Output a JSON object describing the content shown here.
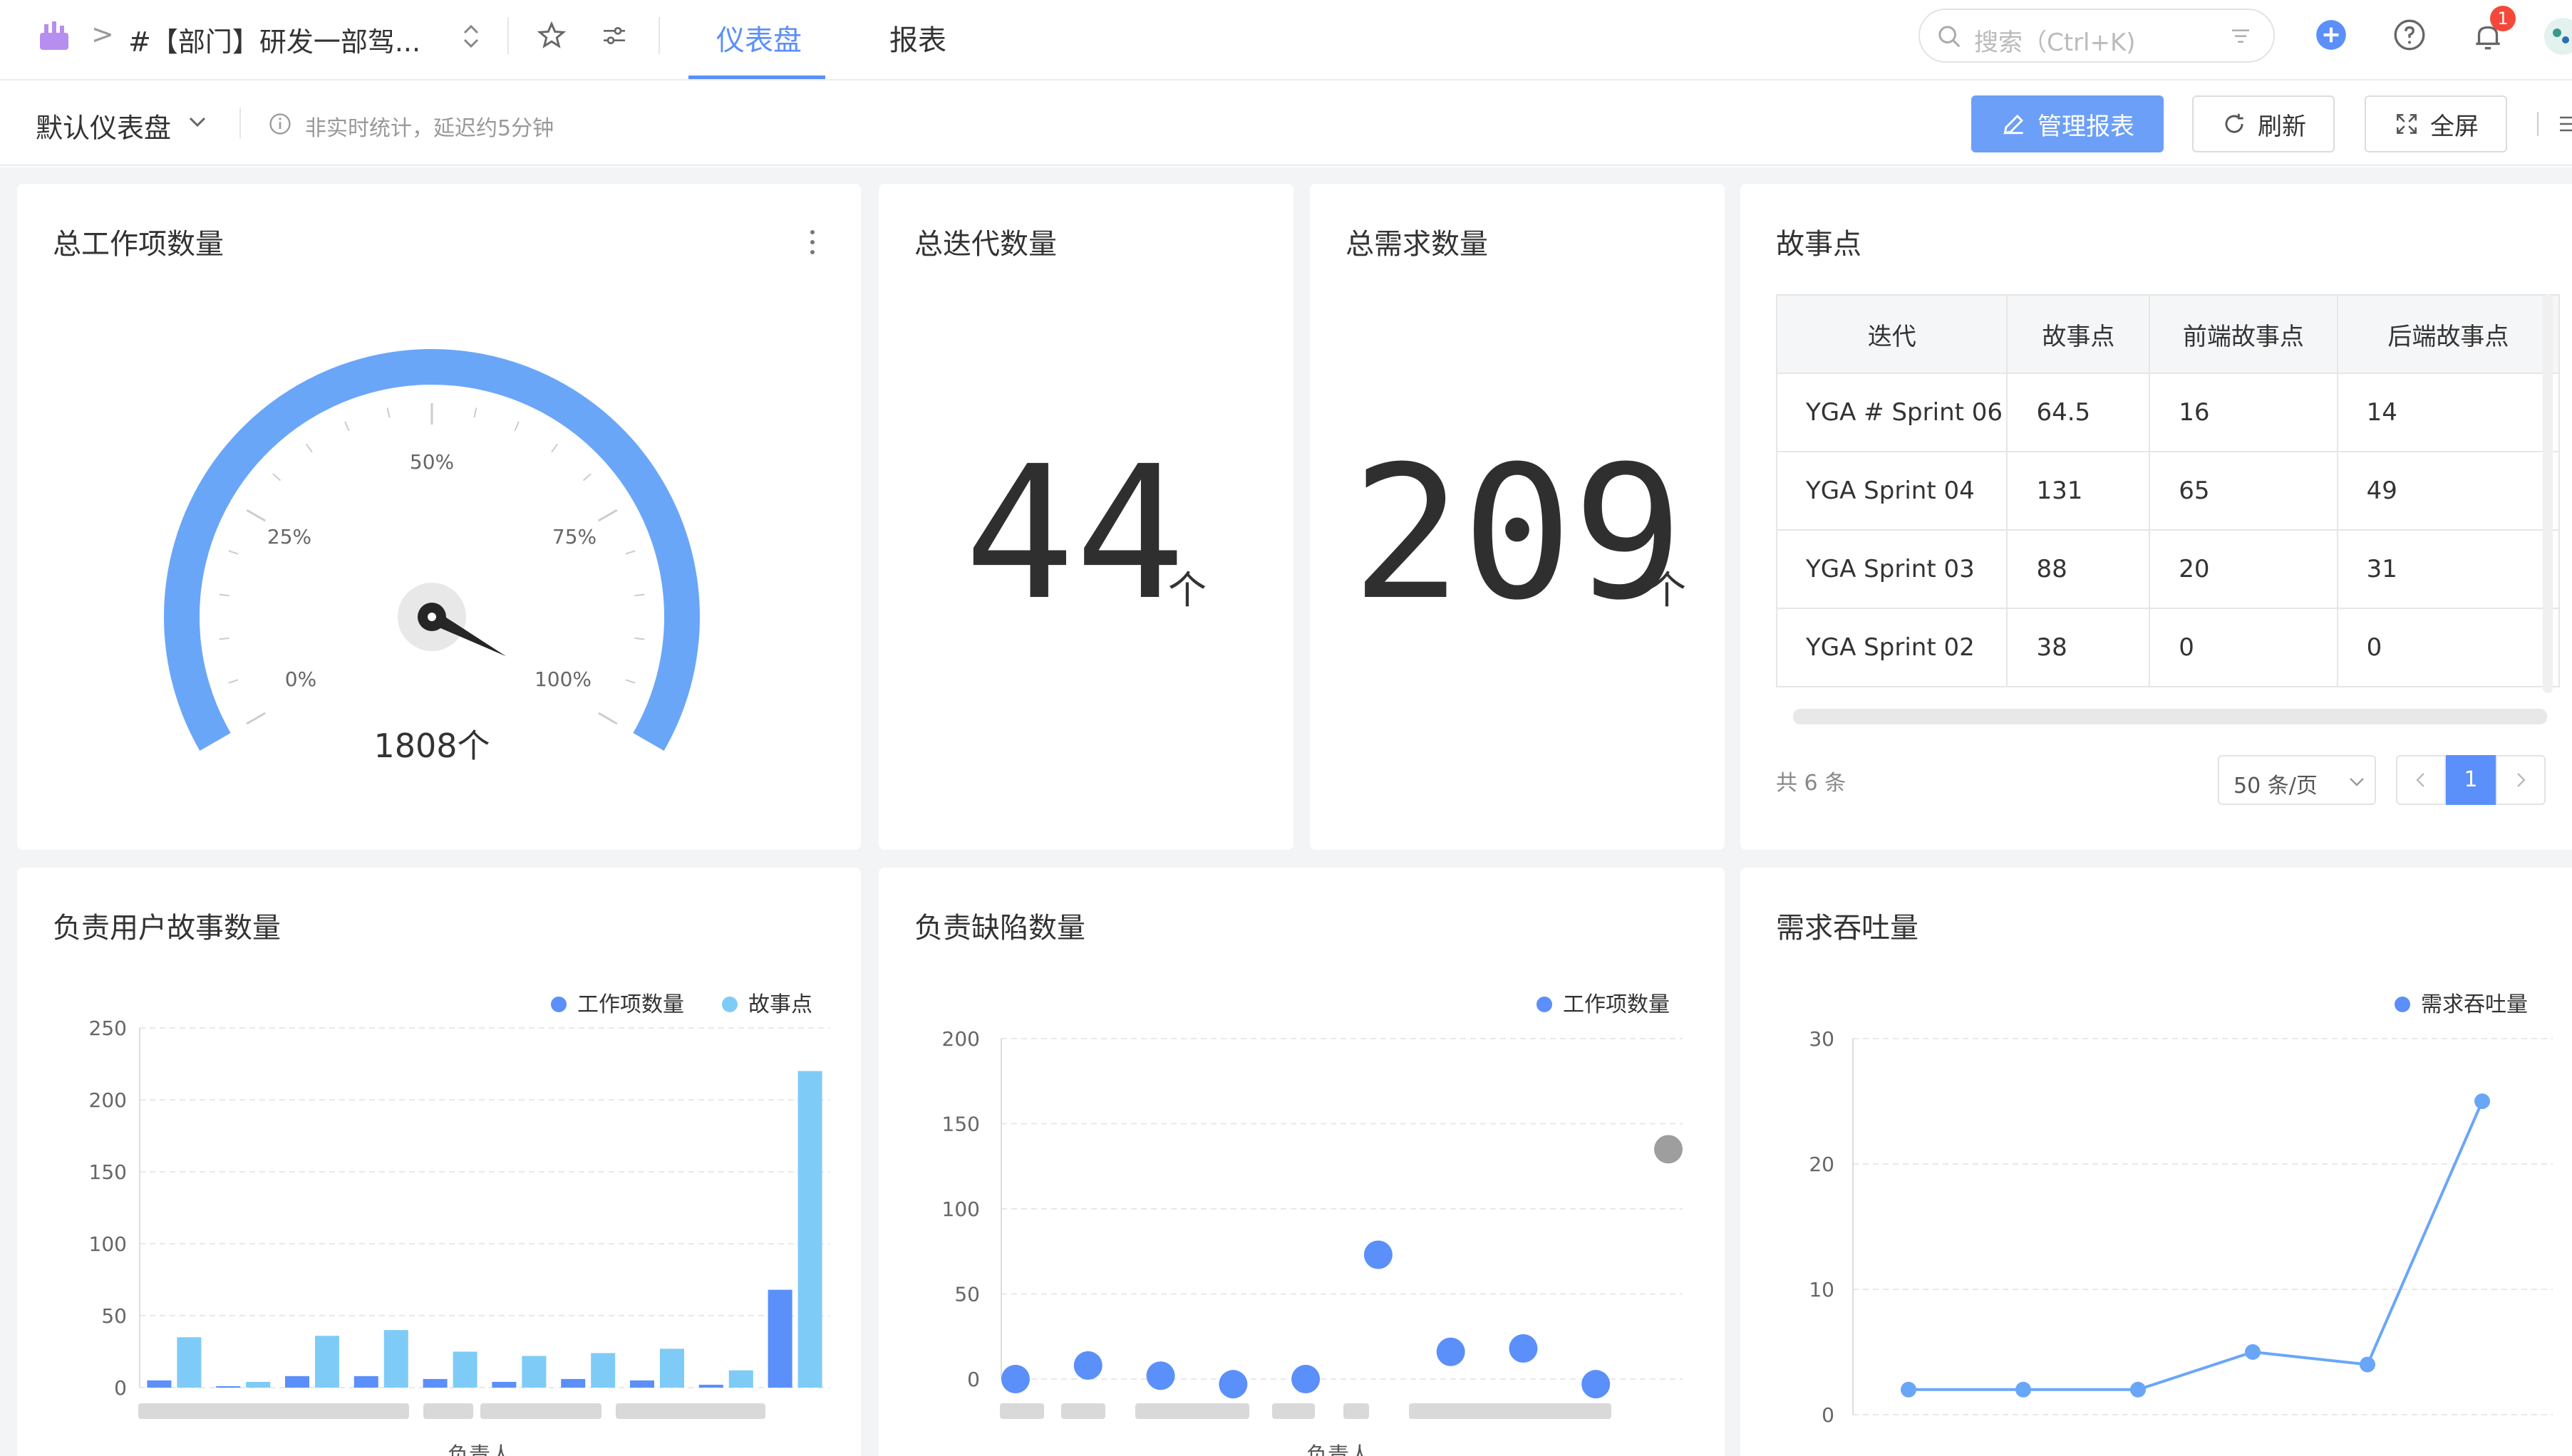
{
  "header": {
    "breadcrumb_sep": ">",
    "project_title": "#【部门】研发一部驾...",
    "tabs": [
      {
        "label": "仪表盘",
        "active": true
      },
      {
        "label": "报表",
        "active": false
      }
    ],
    "search_placeholder": "搜索（Ctrl+K)",
    "notification_count": "1"
  },
  "subbar": {
    "dashboard_name": "默认仪表盘",
    "notice": "非实时统计，延迟约5分钟",
    "buttons": {
      "manage": "管理报表",
      "refresh": "刷新",
      "fullscreen": "全屏"
    }
  },
  "colors": {
    "accent": "#5b8ff9",
    "gauge": "#6aa6f8",
    "series_light": "#7ecbf7",
    "grey_point": "#9e9e9e"
  },
  "cards": {
    "total_workitems": {
      "title": "总工作项数量",
      "gauge_labels": [
        "0%",
        "25%",
        "50%",
        "75%",
        "100%"
      ],
      "value_text": "1808个",
      "gauge_percent": 100
    },
    "total_iterations": {
      "title": "总迭代数量",
      "value": "44",
      "unit": "个"
    },
    "total_requirements": {
      "title": "总需求数量",
      "value": "209",
      "unit": "个"
    },
    "story_points": {
      "title": "故事点",
      "columns": [
        "迭代",
        "故事点",
        "前端故事点",
        "后端故事点"
      ],
      "rows": [
        [
          "YGA # Sprint 06",
          "64.5",
          "16",
          "14"
        ],
        [
          "YGA Sprint 04",
          "131",
          "65",
          "49"
        ],
        [
          "YGA Sprint 03",
          "88",
          "20",
          "31"
        ],
        [
          "YGA Sprint 02",
          "38",
          "0",
          "0"
        ]
      ],
      "total_prefix": "共",
      "total_count": "6",
      "total_suffix": "条",
      "page_size": "50 条/页",
      "current_page": "1"
    },
    "user_story_count": {
      "title": "负责用户故事数量",
      "xlabel": "负责人"
    },
    "defect_count": {
      "title": "负责缺陷数量",
      "xlabel": "负责人"
    },
    "throughput": {
      "title": "需求吞吐量"
    }
  },
  "chart_data": [
    {
      "type": "bar",
      "title": "负责用户故事数量",
      "xlabel": "负责人",
      "ylim": [
        0,
        250
      ],
      "yticks": [
        0,
        50,
        100,
        150,
        200,
        250
      ],
      "legend": "top-right",
      "series": [
        {
          "name": "工作项数量",
          "values": [
            5,
            1,
            8,
            8,
            6,
            4,
            6,
            5,
            2,
            68
          ]
        },
        {
          "name": "故事点",
          "values": [
            35,
            4,
            36,
            40,
            25,
            22,
            24,
            27,
            12,
            220
          ]
        }
      ]
    },
    {
      "type": "scatter",
      "title": "负责缺陷数量",
      "xlabel": "负责人",
      "ylim": [
        0,
        200
      ],
      "yticks": [
        0,
        50,
        100,
        150,
        200
      ],
      "legend": "top-right",
      "series": [
        {
          "name": "工作项数量",
          "values": [
            0,
            8,
            2,
            -3,
            0,
            73,
            16,
            18,
            -3,
            135
          ]
        }
      ]
    },
    {
      "type": "line",
      "title": "需求吞吐量",
      "ylim": [
        0,
        30
      ],
      "yticks": [
        0,
        10,
        20,
        30
      ],
      "legend": "top-right",
      "series": [
        {
          "name": "需求吞吐量",
          "values": [
            2,
            2,
            2,
            5,
            4,
            25
          ]
        }
      ]
    }
  ]
}
